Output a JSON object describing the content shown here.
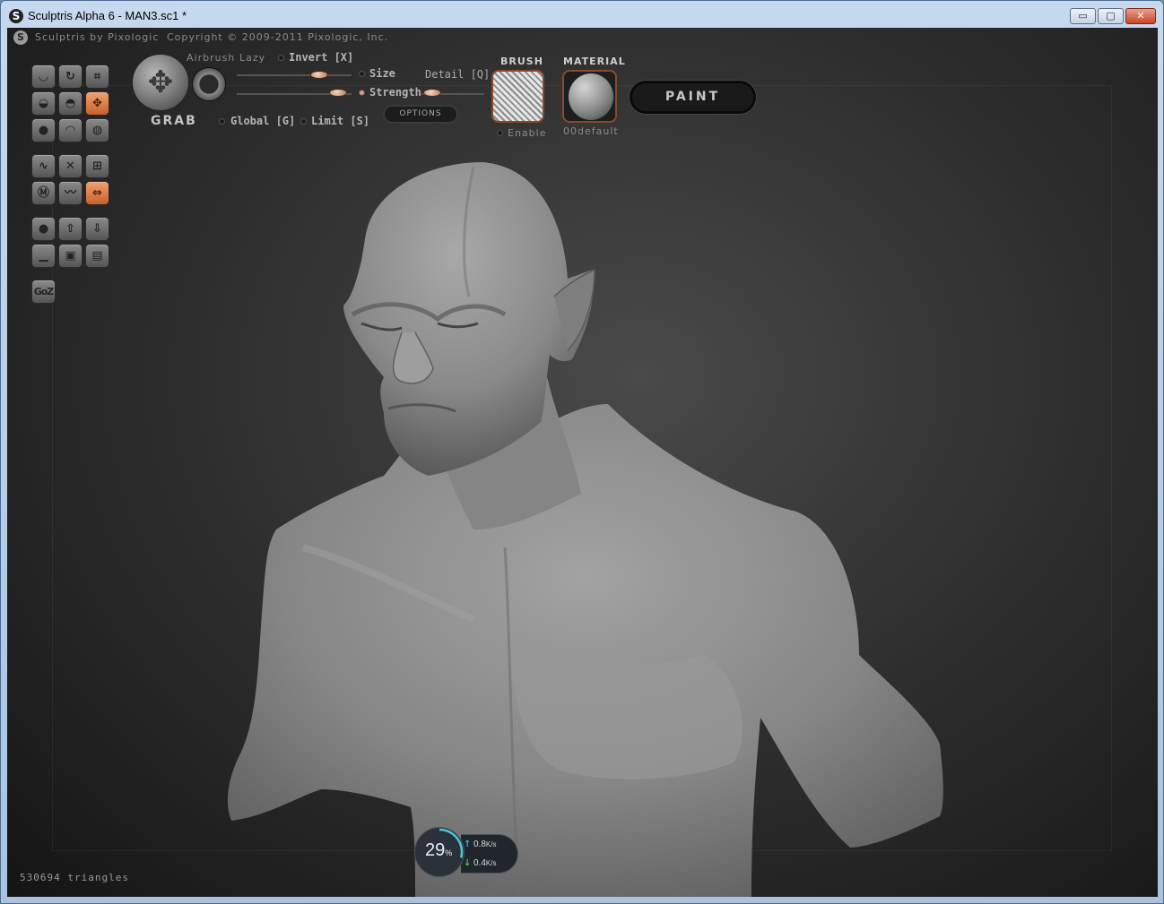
{
  "window": {
    "title": "Sculptris Alpha 6 - MAN3.sc1 *",
    "controls": {
      "minimize": "▭",
      "maximize": "▢",
      "close": "✕"
    }
  },
  "header": {
    "app_name": "Sculptris by Pixologic",
    "copyright": "Copyright © 2009-2011 Pixologic, Inc."
  },
  "brush_panel": {
    "tool_name": "GRAB",
    "airbrush_label": "Airbrush",
    "lazy_label": "Lazy",
    "invert_label": "Invert [X]",
    "size_label": "Size",
    "detail_label": "Detail [Q]",
    "strength_label": "Strength",
    "options_label": "OPTIONS",
    "global_label": "Global [G]",
    "limit_label": "Limit [S]",
    "brush_heading": "BRUSH",
    "enable_label": "Enable",
    "material_heading": "MATERIAL",
    "material_name": "00default",
    "paint_label": "PAINT"
  },
  "toolbar": {
    "goz_label": "GoZ",
    "active_tools": [
      "grab",
      "symmetry"
    ]
  },
  "status": {
    "triangles": "530694 triangles"
  },
  "net_monitor": {
    "percent": "29",
    "percent_unit": "%",
    "up": "0.8",
    "down": "0.4",
    "unit": "K/s"
  },
  "colors": {
    "accent": "#c8602c",
    "background": "#2a2a2a",
    "model": "#8c8c8c"
  }
}
